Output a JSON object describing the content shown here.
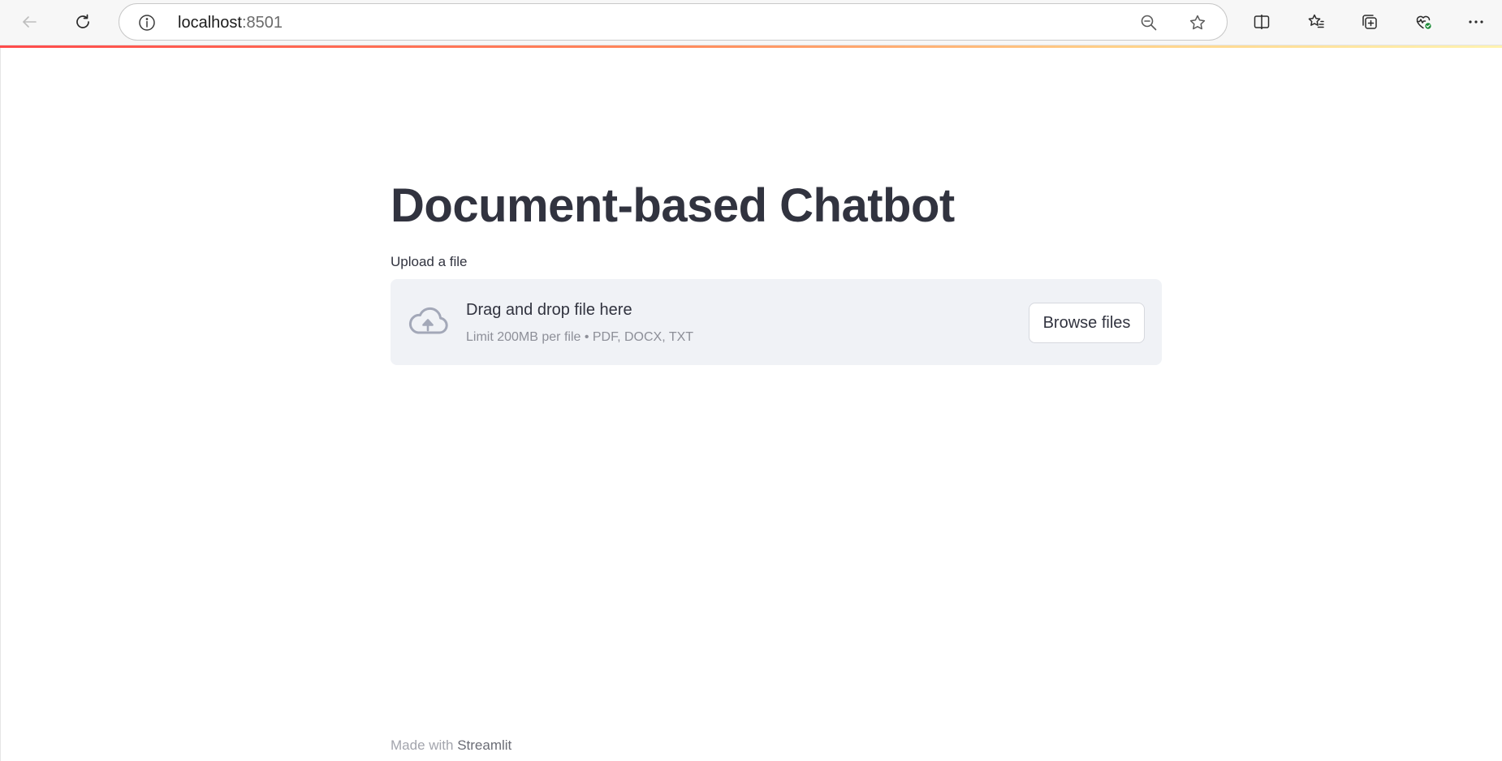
{
  "browser": {
    "url_host": "localhost",
    "url_port": ":8501",
    "icons": {
      "back": "back-arrow-icon",
      "refresh": "refresh-icon",
      "info": "info-icon",
      "zoom": "zoom-out-icon",
      "favorite": "star-icon",
      "split": "split-screen-icon",
      "favorites_list": "favorites-icon",
      "collections": "collections-icon",
      "health": "browser-essentials-icon",
      "menu": "more-menu-icon"
    },
    "accent_colors": [
      "#ff4b4b",
      "#ffd28a"
    ]
  },
  "app": {
    "title": "Document-based Chatbot",
    "uploader": {
      "label": "Upload a file",
      "drop_title": "Drag and drop file here",
      "drop_subtitle": "Limit 200MB per file • PDF, DOCX, TXT",
      "button_label": "Browse files",
      "icon": "cloud-upload-icon"
    },
    "footer": {
      "prefix": "Made with ",
      "brand": "Streamlit"
    }
  }
}
